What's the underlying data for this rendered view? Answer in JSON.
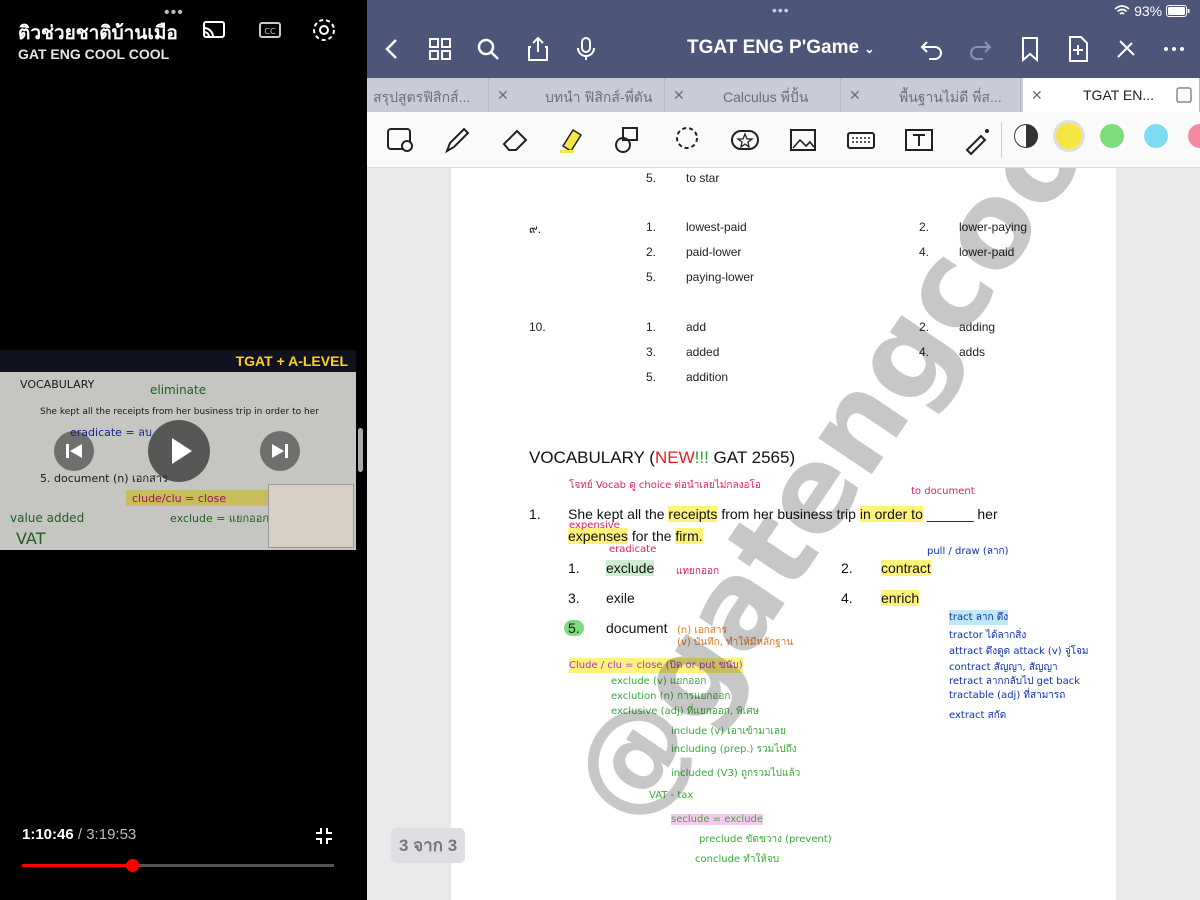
{
  "youtube": {
    "title": "ติวช่วยชาติบ้านเมือ",
    "channel": "GAT ENG COOL COOL",
    "banner": "TGAT + A-LEVEL",
    "time_current": "1:10:46",
    "time_separator": " / ",
    "time_total": "3:19:53",
    "progress": 0.354,
    "icons": [
      "cast-icon",
      "cc-icon",
      "settings-icon",
      "play-icon",
      "previous-icon",
      "next-icon",
      "fullscreen-exit-icon"
    ]
  },
  "status": {
    "battery": "93%"
  },
  "goodnotes": {
    "doc_title": "TGAT ENG P'Game",
    "tabs": [
      {
        "label": "สรุปสูตรฟิสิกส์..."
      },
      {
        "label": "บทนำ ฟิสิกส์-พี่ตัน"
      },
      {
        "label": "Calculus พี่ปั้น"
      },
      {
        "label": "พื้นฐานไม่ดี พี่ส..."
      },
      {
        "label": "TGAT EN..."
      }
    ],
    "page_indicator": "3 จาก 3",
    "colors": {
      "accent": "#4b5678",
      "black": "#333333",
      "yellow": "#f5e642",
      "green": "#7ddc7d",
      "cyan": "#7fdcf0",
      "pink": "#f38aa0"
    }
  },
  "page": {
    "rows": [
      {
        "num": "5.",
        "text": "to star"
      },
      {
        "qnum": "๙."
      },
      {
        "num": "1.",
        "text": "lowest-paid"
      },
      {
        "num": "2.",
        "text": "lower-paying"
      },
      {
        "num": "2.",
        "text": "paid-lower"
      },
      {
        "num": "4.",
        "text": "lower-paid"
      },
      {
        "num": "5.",
        "text": "paying-lower"
      },
      {
        "qnum": "10."
      },
      {
        "num": "1.",
        "text": "add"
      },
      {
        "num": "2.",
        "text": "adding"
      },
      {
        "num": "3.",
        "text": "added"
      },
      {
        "num": "4.",
        "text": "adds"
      },
      {
        "num": "5.",
        "text": "addition"
      }
    ],
    "vocab_heading_pre": "VOCABULARY (",
    "vocab_heading_new": "NEW",
    "vocab_heading_ex": "!!!",
    "vocab_heading_post": " GAT 2565)",
    "q1_num": "1.",
    "q1_a": "She kept all the ",
    "q1_receipts": "receipts",
    "q1_b": " from her business trip ",
    "q1_inorder": "in order to",
    "q1_c": " ______ her",
    "q1_expenses": "expenses",
    "q1_d": " for the ",
    "q1_firm": "firm.",
    "choices": [
      {
        "num": "1.",
        "word": "exclude"
      },
      {
        "num": "2.",
        "word": "contract"
      },
      {
        "num": "3.",
        "word": "exile"
      },
      {
        "num": "4.",
        "word": "enrich"
      },
      {
        "num": "5.",
        "word": "document"
      }
    ],
    "notes": {
      "n1": "โจทย์ Vocab ดู choice ต่อนำเลยไม่กลงอโอ",
      "n2": "expensive",
      "n3": "eradicate",
      "n4": "แทยกออก",
      "n5": "(n) เอกสาร",
      "n6": "(v) บันทึก, ทำให้มีหลักฐาน",
      "n7": "Clude / clu = close (ปิด or put ขนับ)",
      "n8": "exclude (v) แยกออก",
      "n9": "exclution (n) การแยกออก",
      "n10": "exclusive (adj) ที่แยกออก, พิเศษ",
      "n11": "include (v) เอาเข้ามาเลย",
      "n12": "including (prep.) รวมไปถึง",
      "n13": "included (V3) ถูกรวมไปแล้ว",
      "n14": "VAT - tax",
      "n15": "seclude = exclude",
      "n16": "preclude ขัดขวาง (prevent)",
      "n17": "conclude ทำให้จบ",
      "n18": "to document",
      "n19": "pull / draw (ลาก)",
      "n20": "tract ลาก ดึง",
      "n21": "tractor ได้ลากสิ่ง",
      "n22": "attract ดึงดูด attack (v) จู่โจม",
      "n23": "contract สัญญา, สัญญา",
      "n24": "retract ลากกลับไป get back",
      "n25": "tractable (adj) ที่สามารถ",
      "n26": "extract สกัด",
      "n27": "@gatengcoolcool"
    }
  }
}
